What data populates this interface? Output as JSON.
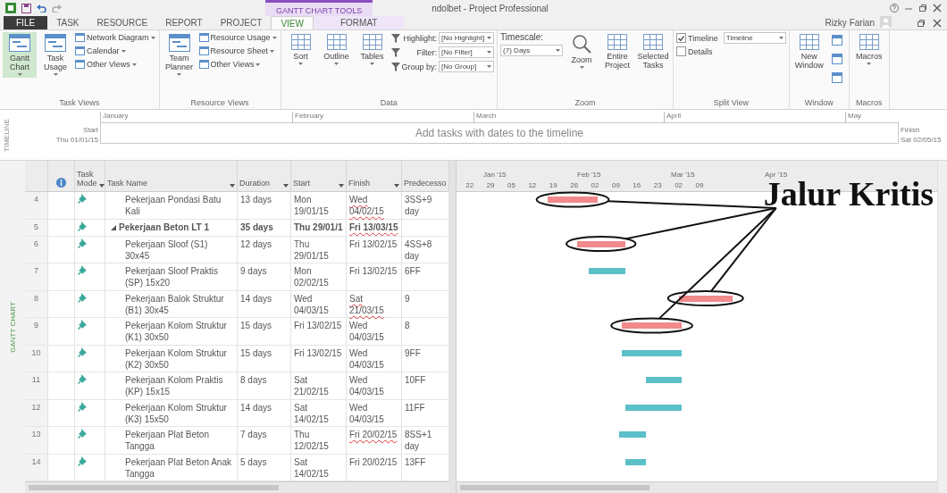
{
  "title_bar": {
    "context_label": "GANTT CHART TOOLS",
    "title": "ndolbet - Project Professional",
    "user": "Rizky Farian"
  },
  "tabs": [
    {
      "label": "FILE",
      "kind": "file",
      "selected": false
    },
    {
      "label": "TASK",
      "kind": "tab",
      "selected": false
    },
    {
      "label": "RESOURCE",
      "kind": "tab",
      "selected": false
    },
    {
      "label": "REPORT",
      "kind": "tab",
      "selected": false
    },
    {
      "label": "PROJECT",
      "kind": "tab",
      "selected": false
    },
    {
      "label": "VIEW",
      "kind": "tab",
      "selected": true
    },
    {
      "label": "FORMAT",
      "kind": "context",
      "selected": false
    }
  ],
  "ribbon": [
    {
      "label": "Task Views",
      "columns": [
        [
          {
            "kind": "view",
            "label": "Gantt Chart",
            "selected": true,
            "dropdown": true
          }
        ],
        [
          {
            "kind": "view",
            "label": "Task Usage",
            "selected": false,
            "dropdown": true
          }
        ],
        [
          {
            "kind": "small",
            "label": "Network Diagram",
            "dropdown": true
          },
          {
            "kind": "small",
            "label": "Calendar",
            "dropdown": true
          },
          {
            "kind": "small",
            "label": "Other Views",
            "dropdown": true
          }
        ]
      ]
    },
    {
      "label": "Resource Views",
      "columns": [
        [
          {
            "kind": "view",
            "label": "Team Planner",
            "selected": false,
            "dropdown": true
          }
        ],
        [
          {
            "kind": "small",
            "label": "Resource Usage",
            "dropdown": true
          },
          {
            "kind": "small",
            "label": "Resource Sheet",
            "dropdown": true
          },
          {
            "kind": "small",
            "label": "Other Views",
            "dropdown": true
          }
        ]
      ]
    },
    {
      "label": "Data",
      "columns": [
        [
          {
            "kind": "large",
            "label": "Sort",
            "dropdown": true
          }
        ],
        [
          {
            "kind": "large",
            "label": "Outline",
            "dropdown": true
          }
        ],
        [
          {
            "kind": "large",
            "label": "Tables",
            "dropdown": true
          }
        ],
        [
          {
            "kind": "field",
            "label": "Highlight:",
            "value": "[No Highlight]"
          },
          {
            "kind": "field",
            "label": "Filter:",
            "value": "[No Filter]"
          },
          {
            "kind": "field",
            "label": "Group by:",
            "value": "[No Group]"
          }
        ]
      ]
    },
    {
      "label": "Zoom",
      "columns": [
        [
          {
            "kind": "stacked-field",
            "label": "Timescale:",
            "value": "(7) Days"
          }
        ],
        [
          {
            "kind": "zoom",
            "label": "Zoom",
            "dropdown": true
          }
        ],
        [
          {
            "kind": "large",
            "label": "Entire Project",
            "dropdown": false
          }
        ],
        [
          {
            "kind": "large",
            "label": "Selected Tasks",
            "dropdown": false
          }
        ]
      ]
    },
    {
      "label": "Split View",
      "columns": [
        [
          {
            "kind": "check",
            "label": "Timeline",
            "checked": true,
            "value": "Timeline"
          },
          {
            "kind": "check",
            "label": "Details",
            "checked": false
          }
        ]
      ]
    },
    {
      "label": "Window",
      "columns": [
        [
          {
            "kind": "large",
            "label": "New Window",
            "dropdown": false
          }
        ],
        [
          {
            "kind": "tiny"
          },
          {
            "kind": "tiny"
          },
          {
            "kind": "tiny"
          }
        ]
      ]
    },
    {
      "label": "Macros",
      "columns": [
        [
          {
            "kind": "large",
            "label": "Macros",
            "dropdown": true
          }
        ]
      ]
    }
  ],
  "timeline": {
    "side_label": "TIMELINE",
    "start_label": "Start",
    "start_date": "Thu 01/01/15",
    "months": [
      "January",
      "February",
      "March",
      "April",
      "May"
    ],
    "hint": "Add tasks with dates to the timeline",
    "finish_label": "Finish",
    "finish_date": "Sat 02/05/15"
  },
  "view_label": "GANTT CHART",
  "table": {
    "columns": [
      {
        "label": "Task Mode",
        "filter": true
      },
      {
        "label": "Task Name",
        "filter": true
      },
      {
        "label": "Duration",
        "filter": true
      },
      {
        "label": "Start",
        "filter": true
      },
      {
        "label": "Finish",
        "filter": true
      },
      {
        "label": "Predecesso"
      }
    ],
    "rows": [
      {
        "id": "4",
        "kind": "task",
        "name": "Pekerjaan Pondasi Batu Kali",
        "duration": "13 days",
        "start": "Mon 19/01/15",
        "finish": "Wed 04/02/15",
        "finish_marked": true,
        "predecessors": "3SS+9 day",
        "critical": true
      },
      {
        "id": "5",
        "kind": "summary",
        "expanded": true,
        "name": "Pekerjaan Beton LT 1",
        "duration": "35 days",
        "start": "Thu 29/01/1",
        "finish": "Fri 13/03/15",
        "finish_marked": true
      },
      {
        "id": "6",
        "kind": "task",
        "name": "Pekerjaan Sloof (S1) 30x45",
        "duration": "12 days",
        "start": "Thu 29/01/15",
        "finish": "Fri 13/02/15",
        "finish_marked": false,
        "predecessors": "4SS+8 day",
        "critical": true
      },
      {
        "id": "7",
        "kind": "task",
        "name": "Pekerjaan Sloof Praktis (SP) 15x20",
        "duration": "9 days",
        "start": "Mon 02/02/15",
        "finish": "Fri 13/02/15",
        "finish_marked": false,
        "predecessors": "6FF",
        "critical": false
      },
      {
        "id": "8",
        "kind": "task",
        "name": "Pekerjaan Balok Struktur (B1) 30x45",
        "duration": "14 days",
        "start": "Wed 04/03/15",
        "finish": "Sat 21/03/15",
        "finish_marked": true,
        "predecessors": "9",
        "critical": true
      },
      {
        "id": "9",
        "kind": "task",
        "name": "Pekerjaan Kolom Struktur (K1) 30x50",
        "duration": "15 days",
        "start": "Fri 13/02/15",
        "finish": "Wed 04/03/15",
        "finish_marked": false,
        "predecessors": "8",
        "critical": true
      },
      {
        "id": "10",
        "kind": "task",
        "name": "Pekerjaan Kolom Struktur (K2) 30x50",
        "duration": "15 days",
        "start": "Fri 13/02/15",
        "finish": "Wed 04/03/15",
        "finish_marked": false,
        "predecessors": "9FF",
        "critical": false
      },
      {
        "id": "11",
        "kind": "task",
        "name": "Pekerjaan Kolom Praktis (KP) 15x15",
        "duration": "8 days",
        "start": "Sat 21/02/15",
        "finish": "Wed 04/03/15",
        "finish_marked": false,
        "predecessors": "10FF",
        "critical": false
      },
      {
        "id": "12",
        "kind": "task",
        "name": "Pekerjaan Kolom Struktur (K3) 15x50",
        "duration": "14 days",
        "start": "Sat 14/02/15",
        "finish": "Wed 04/03/15",
        "finish_marked": false,
        "predecessors": "11FF",
        "critical": false
      },
      {
        "id": "13",
        "kind": "task",
        "name": "Pekerjaan Plat Beton Tangga",
        "duration": "7 days",
        "start": "Thu 12/02/15",
        "finish": "Fri 20/02/15",
        "finish_marked": true,
        "predecessors": "8SS+1 day",
        "critical": false
      },
      {
        "id": "14",
        "kind": "task",
        "name": "Pekerjaan Plat Beton Anak Tangga",
        "duration": "5 days",
        "start": "Sat 14/02/15",
        "finish": "Fri 20/02/15",
        "finish_marked": false,
        "predecessors": "13FF",
        "critical": false
      }
    ]
  },
  "gantt": {
    "months": [
      "Jan '15",
      "Feb '15",
      "Mar '15",
      "Apr '15"
    ],
    "weeks": [
      "22",
      "29",
      "05",
      "12",
      "19",
      "26",
      "02",
      "09",
      "16",
      "23",
      "02",
      "09"
    ],
    "annotation": "Jalur Kritis"
  }
}
